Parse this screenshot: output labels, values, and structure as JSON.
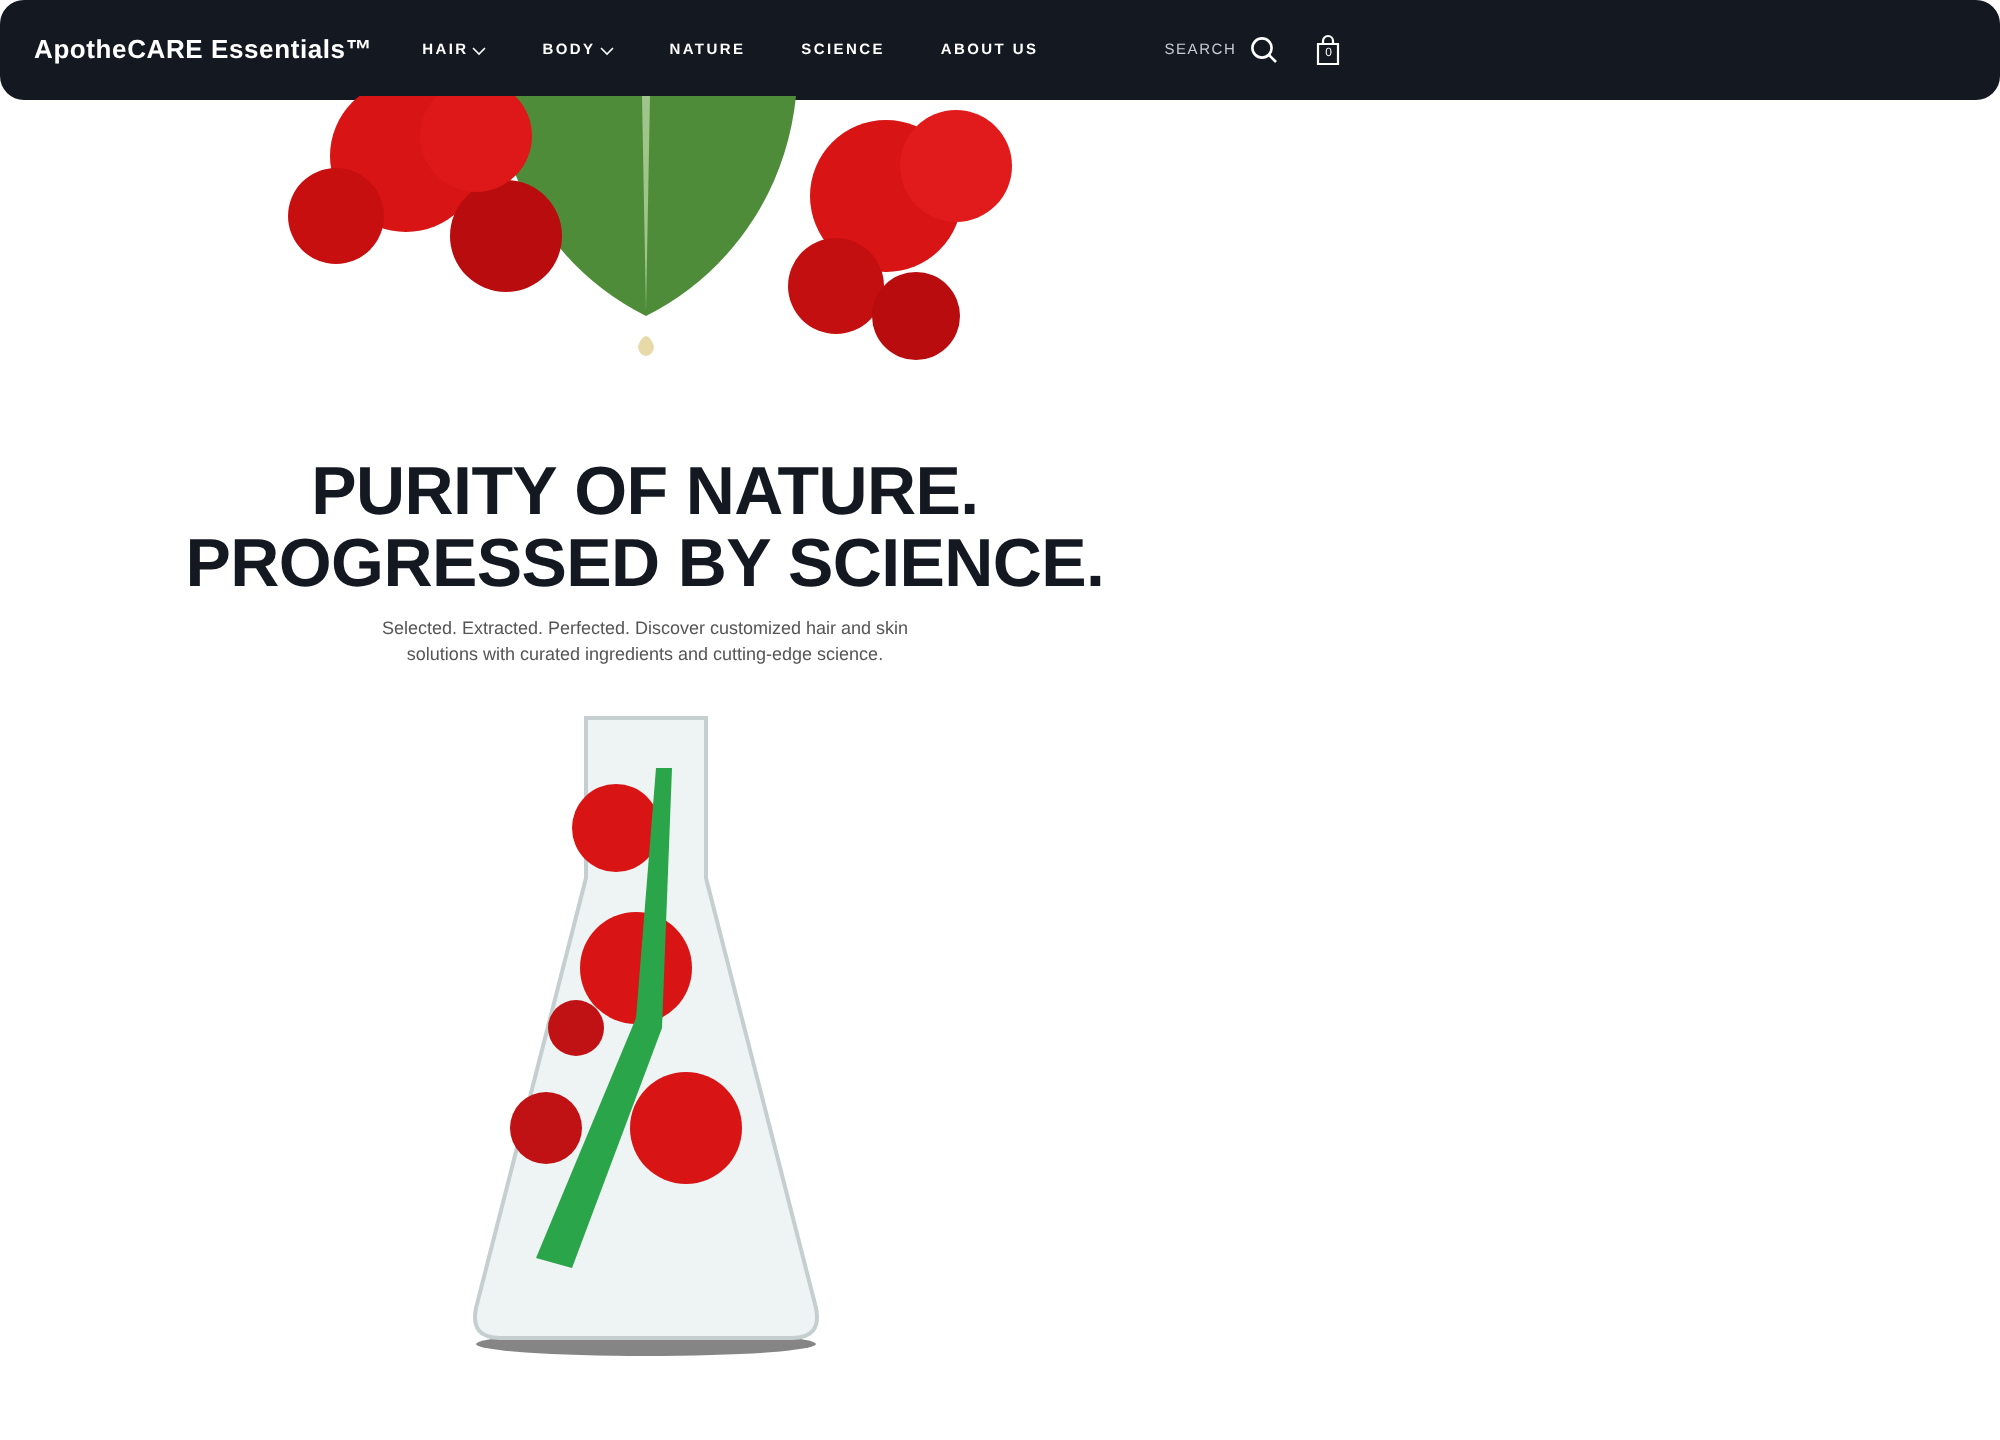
{
  "header": {
    "brand": "ApotheCARE Essentials™",
    "nav": [
      {
        "label": "HAIR",
        "has_menu": true
      },
      {
        "label": "BODY",
        "has_menu": true
      },
      {
        "label": "NATURE",
        "has_menu": false
      },
      {
        "label": "SCIENCE",
        "has_menu": false
      },
      {
        "label": "ABOUT US",
        "has_menu": false
      }
    ],
    "search_label": "SEARCH",
    "cart_count": "0"
  },
  "hero": {
    "headline": [
      "PURITY OF NATURE.",
      "PROGRESSED BY SCIENCE."
    ],
    "description": "Selected. Extracted. Perfected. Discover customized hair and skin solutions with curated ingredients and cutting-edge science."
  }
}
